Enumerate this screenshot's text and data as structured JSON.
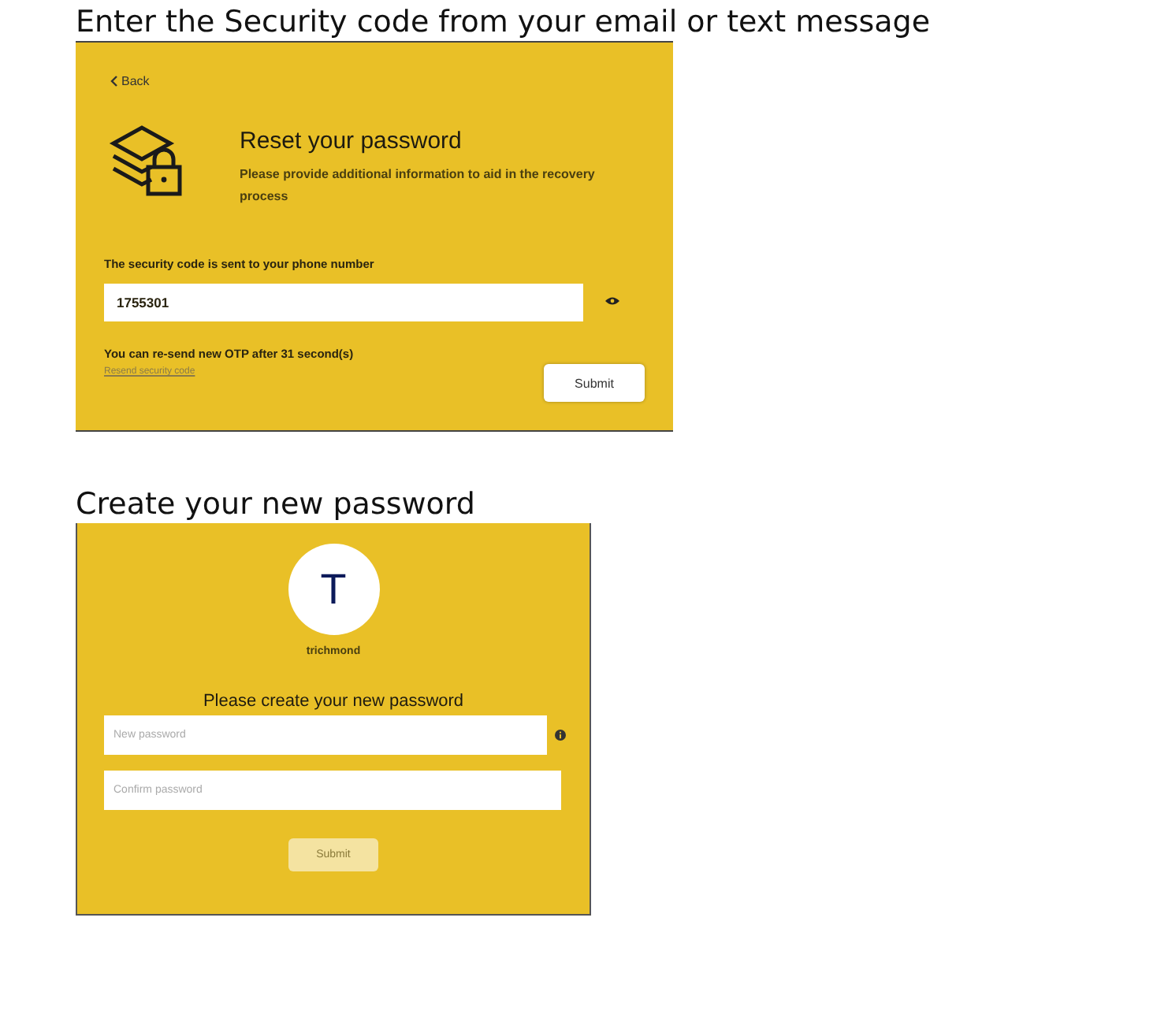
{
  "sections": [
    {
      "heading": "Enter the Security code from your email or text message",
      "panel": {
        "kind": "reset",
        "back": "Back",
        "title": "Reset your password",
        "subtitle": "Please provide additional information to aid in the recovery process",
        "field_label": "The security code is sent to your phone number",
        "code_value": "1755301",
        "countdown": "You can re-send new OTP after 31 second(s)",
        "resend_link": "Resend security code",
        "submit": {
          "label": "Submit",
          "disabled": false
        }
      }
    },
    {
      "heading": "Create your new password",
      "panel": {
        "kind": "create",
        "avatar_letter": "T",
        "username": "trichmond",
        "title": "Please create your new password",
        "new_password": {
          "placeholder": "New password"
        },
        "confirm_password": {
          "placeholder": "Confirm password"
        },
        "submit": {
          "label": "Submit",
          "disabled": true
        }
      }
    }
  ]
}
